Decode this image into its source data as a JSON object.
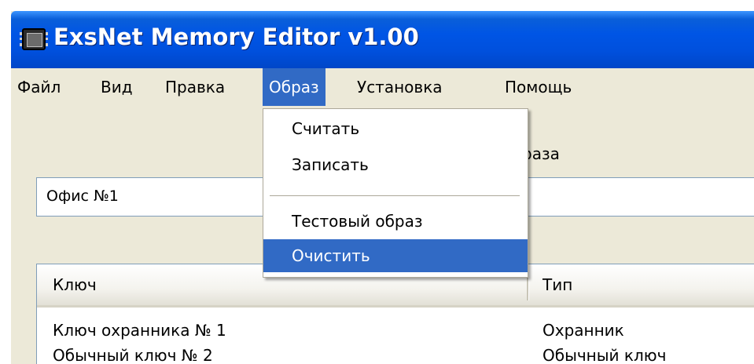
{
  "window": {
    "title": "ExsNet Memory Editor v1.00",
    "icon": "chip-icon"
  },
  "menubar": {
    "items": [
      {
        "label": "Файл"
      },
      {
        "label": "Вид"
      },
      {
        "label": "Правка"
      },
      {
        "label": "Образ",
        "active": true
      },
      {
        "label": "Установка"
      },
      {
        "label": "Помощь"
      }
    ]
  },
  "image_menu": {
    "items": [
      {
        "label": "Считать"
      },
      {
        "label": "Записать"
      },
      {
        "label": "Тестовый образ"
      },
      {
        "label": "Очистить",
        "highlighted": true
      }
    ]
  },
  "content": {
    "label_fragment": "раза",
    "name_value": "Офис №1"
  },
  "keys_table": {
    "columns": [
      "Ключ",
      "Тип"
    ],
    "rows": [
      {
        "key": "Ключ охранника № 1",
        "type": "Охранник"
      },
      {
        "key": "Обычный ключ № 2",
        "type": "Обычный ключ"
      }
    ]
  },
  "colors": {
    "titlebar": "#0055e5",
    "highlight": "#316ac5",
    "face": "#ece9d8"
  }
}
